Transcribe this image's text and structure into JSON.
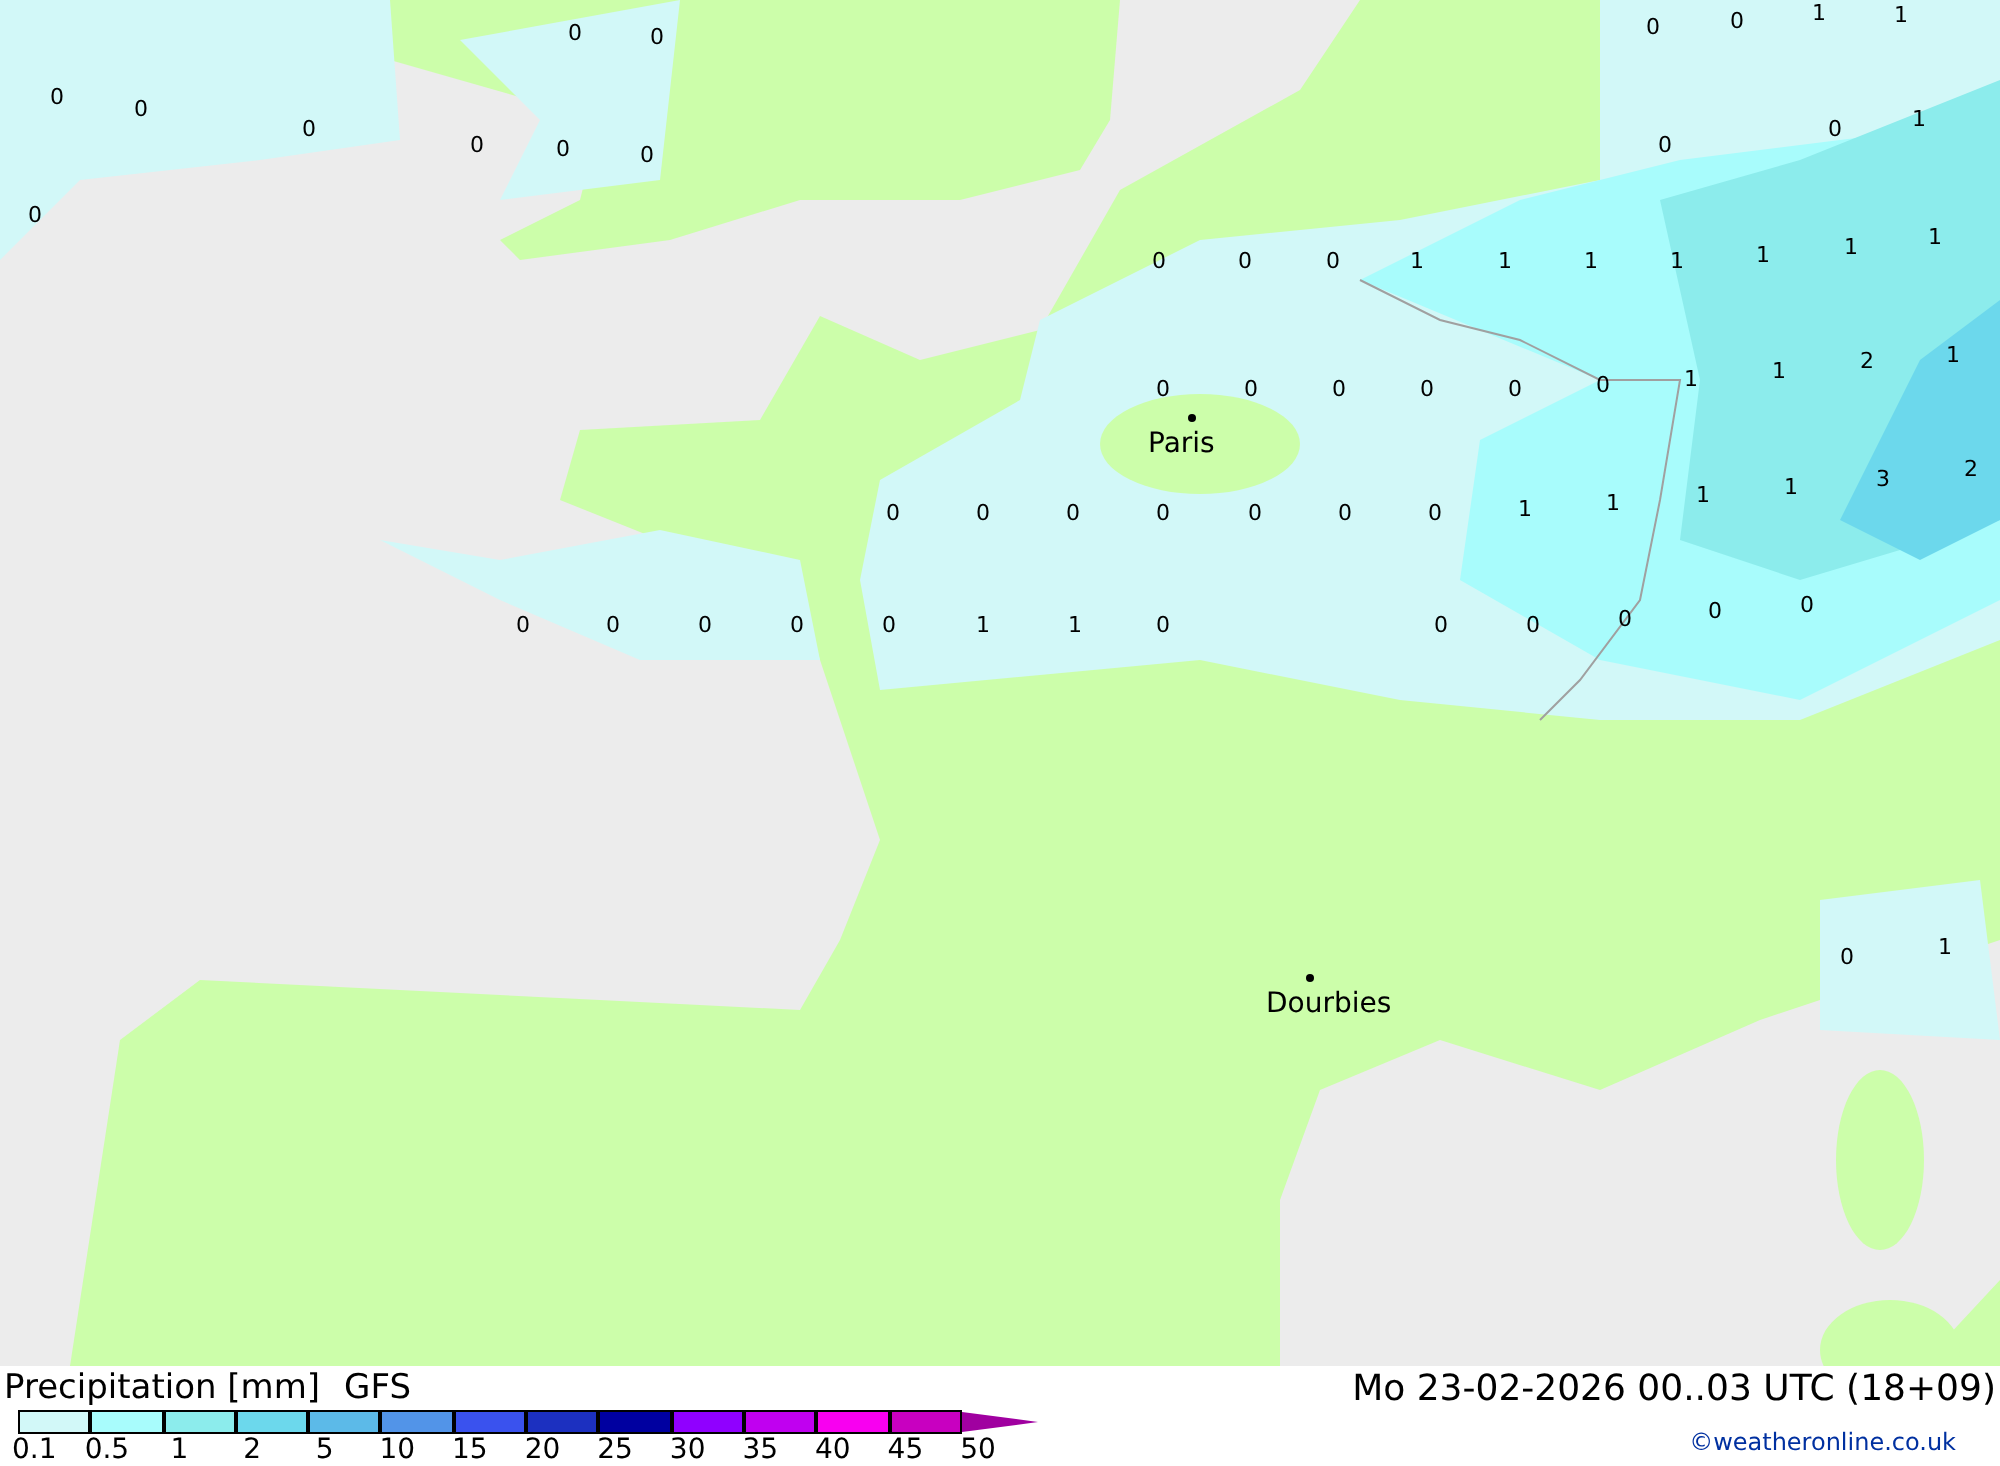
{
  "map": {
    "value_labels": [
      "0",
      "0",
      "0",
      "0",
      "1",
      "1",
      "0",
      "0",
      "0",
      "0",
      "0",
      "0",
      "0",
      "0",
      "1",
      "0",
      "0",
      "0",
      "0",
      "1",
      "1",
      "1",
      "1",
      "1",
      "1",
      "1",
      "0",
      "0",
      "0",
      "0",
      "0",
      "0",
      "1",
      "1",
      "2",
      "1",
      "0",
      "0",
      "0",
      "0",
      "0",
      "0",
      "0",
      "1",
      "1",
      "1",
      "1",
      "3",
      "2",
      "0",
      "0",
      "0",
      "0",
      "0",
      "1",
      "1",
      "0",
      "0",
      "0",
      "0",
      "0",
      "0",
      "0",
      "1"
    ],
    "cities": [
      {
        "name": "Paris"
      },
      {
        "name": "Dourbies"
      }
    ]
  },
  "legend": {
    "title": "Precipitation [mm]",
    "model": "GFS",
    "bins": [
      {
        "kind": "swatch",
        "color": "#d2f8f8"
      },
      {
        "kind": "swatch",
        "color": "#a8fcfc"
      },
      {
        "kind": "swatch",
        "color": "#8cecec"
      },
      {
        "kind": "swatch",
        "color": "#6cd8ec"
      },
      {
        "kind": "swatch",
        "color": "#5cbae8"
      },
      {
        "kind": "swatch",
        "color": "#5294e8"
      },
      {
        "kind": "swatch",
        "color": "#3a52ee"
      },
      {
        "kind": "swatch",
        "color": "#1c30c0"
      },
      {
        "kind": "swatch",
        "color": "#0000a0"
      },
      {
        "kind": "swatch",
        "color": "#9000ff"
      },
      {
        "kind": "swatch",
        "color": "#c000f0"
      },
      {
        "kind": "swatch",
        "color": "#f800f0"
      },
      {
        "kind": "swatch",
        "color": "#c800c0"
      },
      {
        "kind": "arrow",
        "color": "#a000a0"
      }
    ],
    "labels": [
      "0.1",
      "0.5",
      "1",
      "2",
      "5",
      "10",
      "15",
      "20",
      "25",
      "30",
      "35",
      "40",
      "45",
      "50"
    ]
  },
  "valid_time": "Mo 23-02-2026 00..03 UTC (18+09)",
  "credit": "©weatheronline.co.uk"
}
